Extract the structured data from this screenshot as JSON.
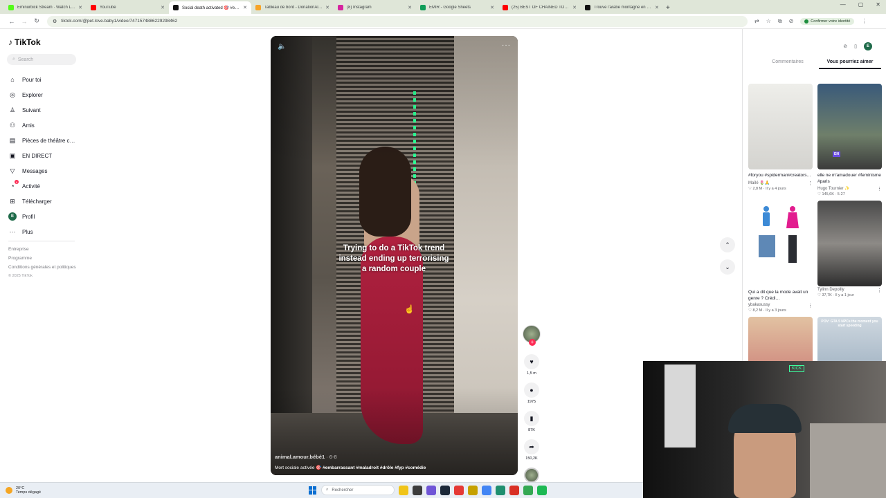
{
  "browser": {
    "tabs": [
      {
        "title": "Eminurbick Stream · Watch Liv…",
        "color": "#53fc18",
        "active": false
      },
      {
        "title": "YouTube",
        "color": "#ff0000",
        "active": false
      },
      {
        "title": "Social death activated 🎯 #emb…",
        "color": "#111111",
        "active": true
      },
      {
        "title": "Tableau de bord - DonationAle…",
        "color": "#f7a427",
        "active": false
      },
      {
        "title": "(8) Instagram",
        "color": "#d6249f",
        "active": false
      },
      {
        "title": "EMIR - Google Sheets",
        "color": "#0f9d58",
        "active": false
      },
      {
        "title": "(25) BEST OF CHAINED TOGETH…",
        "color": "#ff0000",
        "active": false
      },
      {
        "title": "Trouve l'arabe montagne en ar…",
        "color": "#111111",
        "active": false
      }
    ],
    "url": "tiktok.com/@pet.love.baby1/video/7471574886229298462",
    "verify_label": "Confirmer votre identité"
  },
  "sidebar": {
    "brand": "TikTok",
    "search_placeholder": "Search",
    "items": [
      {
        "label": "Pour toi",
        "icon": "home-icon",
        "glyph": "⌂"
      },
      {
        "label": "Explorer",
        "icon": "compass-icon",
        "glyph": "◎"
      },
      {
        "label": "Suivant",
        "icon": "following-icon",
        "glyph": "♙"
      },
      {
        "label": "Amis",
        "icon": "friends-icon",
        "glyph": "⚇"
      },
      {
        "label": "Pièces de théâtre c…",
        "icon": "playlist-icon",
        "glyph": "▤"
      },
      {
        "label": "EN DIRECT",
        "icon": "live-icon",
        "glyph": "▣"
      },
      {
        "label": "Messages",
        "icon": "messages-icon",
        "glyph": "▽"
      },
      {
        "label": "Activité",
        "icon": "activity-icon",
        "glyph": "◔",
        "badge": "6"
      },
      {
        "label": "Télécharger",
        "icon": "download-icon",
        "glyph": "⊞"
      },
      {
        "label": "Profil",
        "icon": "profile-avatar",
        "glyph": "E"
      },
      {
        "label": "Plus",
        "icon": "more-icon",
        "glyph": "···"
      }
    ],
    "footer": {
      "entreprise": "Entreprise",
      "programme": "Programme",
      "conditions": "Conditions générales et politiques",
      "copyright": "© 2025 TikTok"
    }
  },
  "video": {
    "caption": "Trying to do a TikTok trend instead ending up terrorising a random couple",
    "author": "animal.amour.bébé1",
    "date": "· 6-8",
    "desc_prefix": "Mort sociale activée 🎯 ",
    "desc_tags": "#embarrassant #maladroit #drôle #fyp #comédie",
    "actions": {
      "likes": "1,5 m",
      "comments": "1975",
      "saves": "87K",
      "shares": "150,2K"
    }
  },
  "right_panel": {
    "tabs": [
      "Commentaires",
      "Vous pourriez aimer"
    ],
    "active_tab": 1,
    "cards": [
      {
        "caption": "#foryou #spiderman#creators…",
        "author": "Maïlé 🌷🙏",
        "likes": "2,8 M",
        "time": "Il y a 4 jours",
        "bg": "linear-gradient(180deg,#eeeeea,#d4d3cf)"
      },
      {
        "caption": "elle ne m'amadouer #feminisme #paris",
        "author": "Hugo Tournier ✨",
        "likes": "145,6K",
        "time": "5-27",
        "bg": "linear-gradient(180deg,#3a5a7a,#6f7f6a 60%,#3b3b3b)",
        "tag": "EN"
      },
      {
        "caption": "Qui a dit que la mode avait un genre ? Crédi…",
        "author": "ybakasussy",
        "likes": "8,2 M",
        "time": "Il y a 3 jours",
        "bg": "#ffffff"
      },
      {
        "caption": "",
        "author": "Tylinn Depoilly",
        "likes": "37,7K",
        "time": "Il y a 1 jour",
        "bg": "linear-gradient(180deg,#4a4a4a,#8d8a86 50%,#2d2d2d)"
      },
      {
        "caption": "",
        "author": "",
        "likes": "",
        "time": "",
        "bg": "linear-gradient(180deg,#e2c2a2,#c46a6a)"
      },
      {
        "caption": "",
        "author": "",
        "likes": "",
        "time": "",
        "bg": "linear-gradient(180deg,#cfd8e0,#8aa0b4)",
        "overlay": "POV: GTA 5 NPCs the moment you start speeding"
      }
    ]
  },
  "taskbar": {
    "temp": "20°C",
    "weather": "Temps dégagé",
    "search_placeholder": "Rechercher",
    "apps": [
      "#f0c419",
      "#3c3c3c",
      "#6f55d6",
      "#1b2838",
      "#e53935",
      "#c6a100",
      "#4285f4",
      "#1f8f6f",
      "#d93025",
      "#34a853",
      "#1db954"
    ]
  },
  "webcam": {
    "tag": "KICK"
  }
}
